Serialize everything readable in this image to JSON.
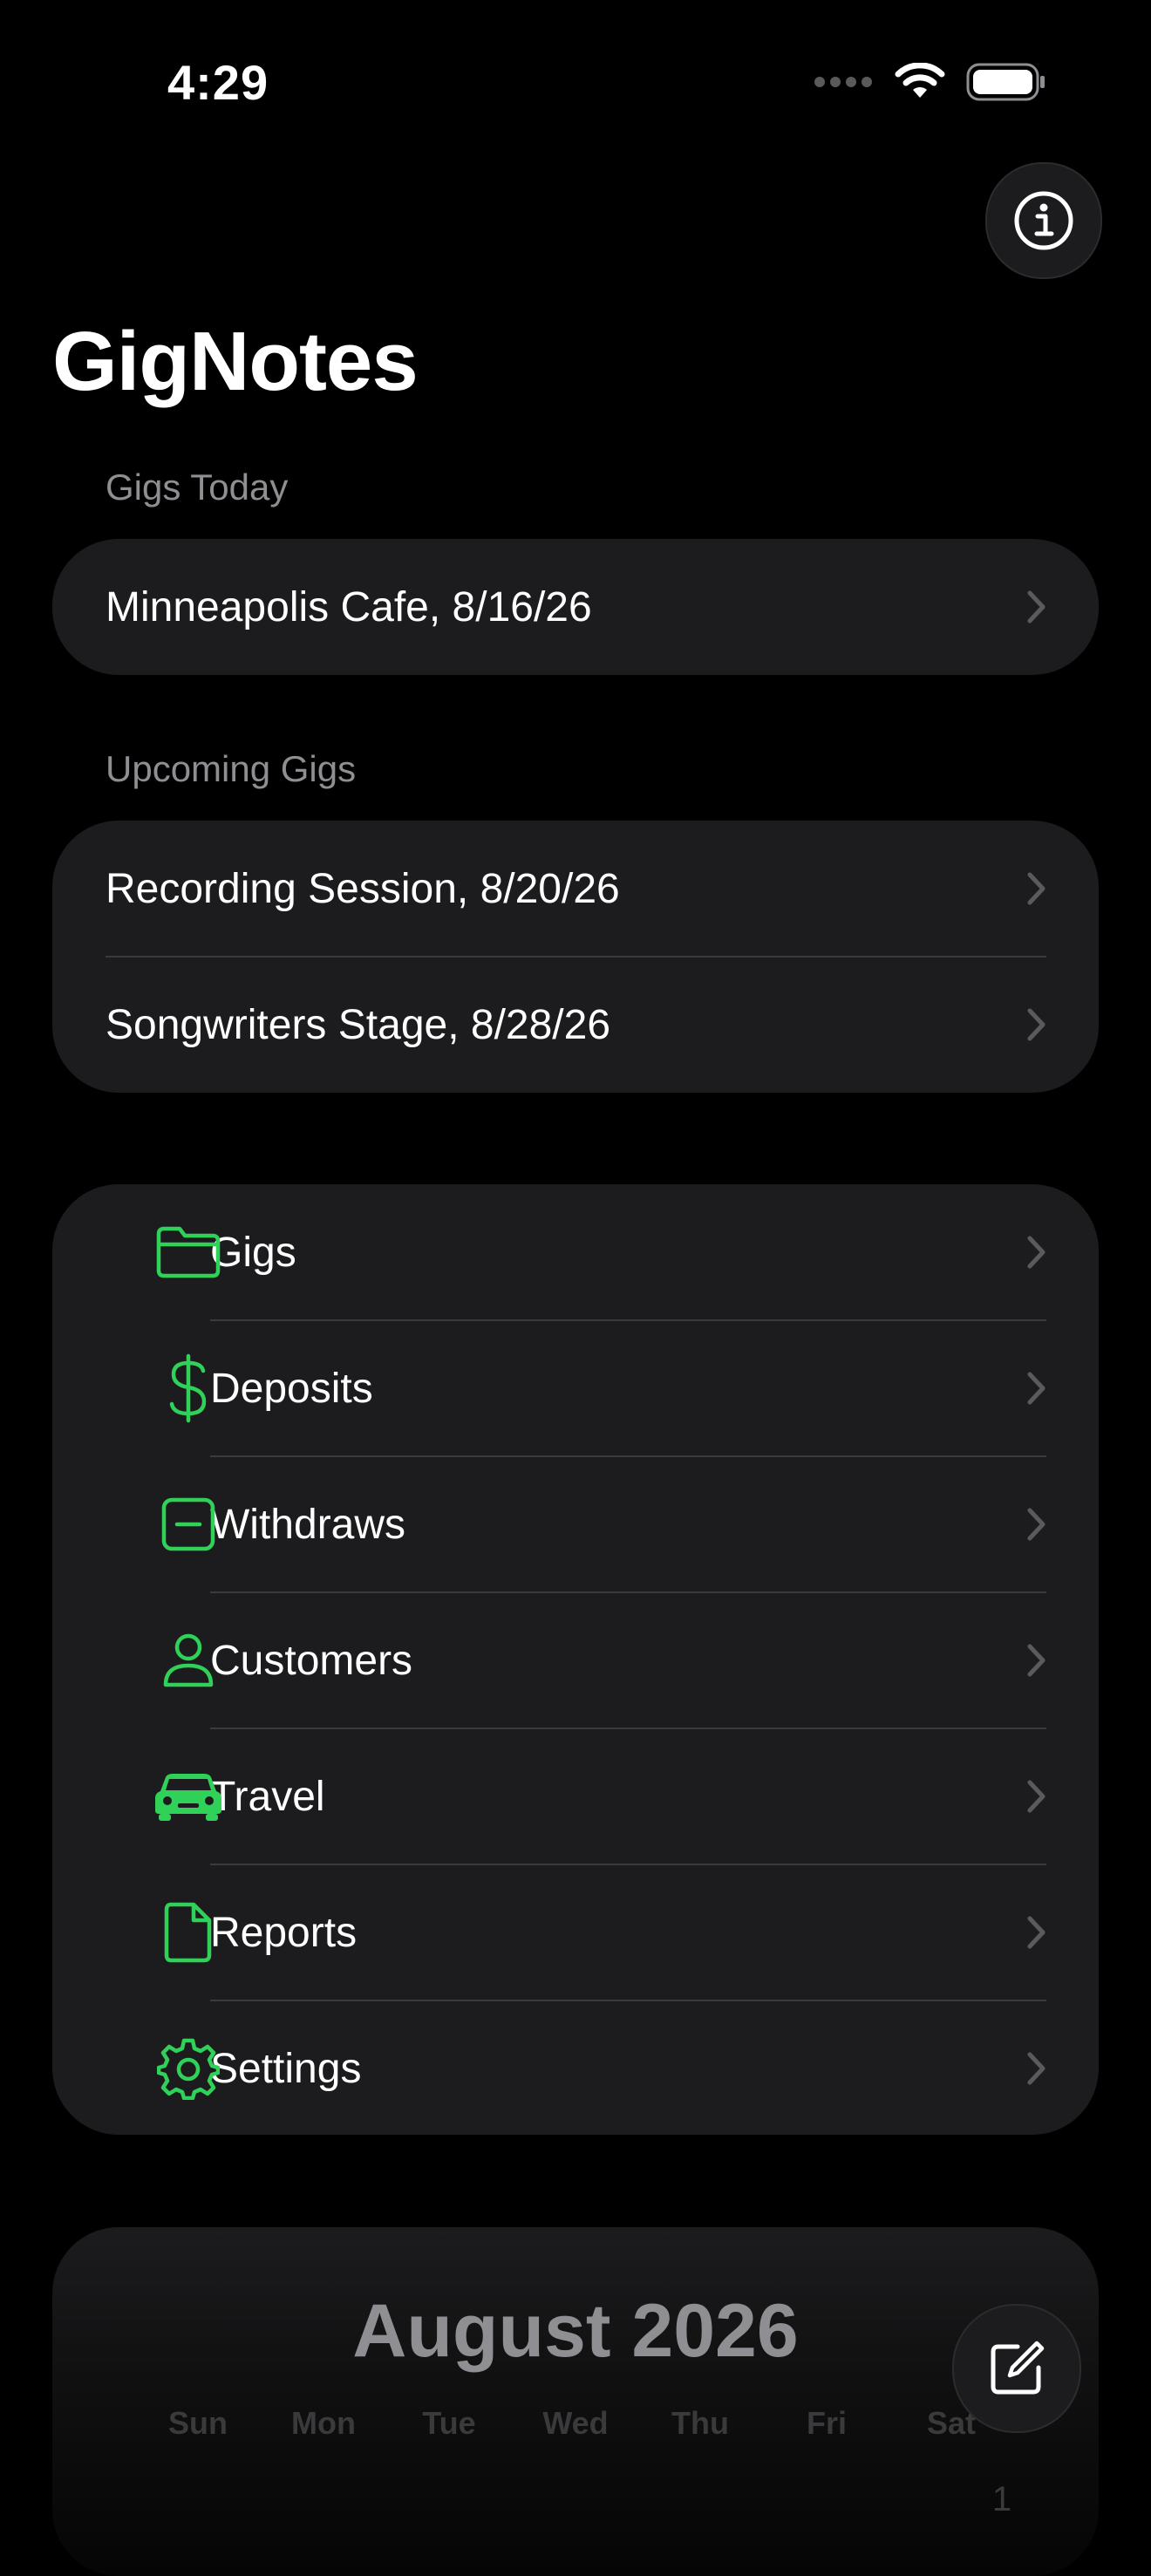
{
  "status_bar": {
    "time": "4:29"
  },
  "app": {
    "title": "GigNotes"
  },
  "sections": {
    "today": {
      "label": "Gigs Today",
      "items": [
        {
          "label": "Minneapolis Cafe, 8/16/26"
        }
      ]
    },
    "upcoming": {
      "label": "Upcoming Gigs",
      "items": [
        {
          "label": "Recording Session, 8/20/26"
        },
        {
          "label": "Songwriters Stage, 8/28/26"
        }
      ]
    }
  },
  "menu": {
    "items": [
      {
        "label": "Gigs",
        "icon": "folder-icon"
      },
      {
        "label": "Deposits",
        "icon": "dollar-icon"
      },
      {
        "label": "Withdraws",
        "icon": "minus-square-icon"
      },
      {
        "label": "Customers",
        "icon": "person-icon"
      },
      {
        "label": "Travel",
        "icon": "car-icon"
      },
      {
        "label": "Reports",
        "icon": "document-icon"
      },
      {
        "label": "Settings",
        "icon": "gear-icon"
      }
    ]
  },
  "calendar": {
    "month": "August 2026",
    "weekdays": [
      "Sun",
      "Mon",
      "Tue",
      "Wed",
      "Thu",
      "Fri",
      "Sat"
    ],
    "first_day": "1"
  },
  "colors": {
    "accent": "#30d158",
    "background": "#000000",
    "card": "#1c1c1e",
    "secondary_text": "#8e8e93"
  }
}
